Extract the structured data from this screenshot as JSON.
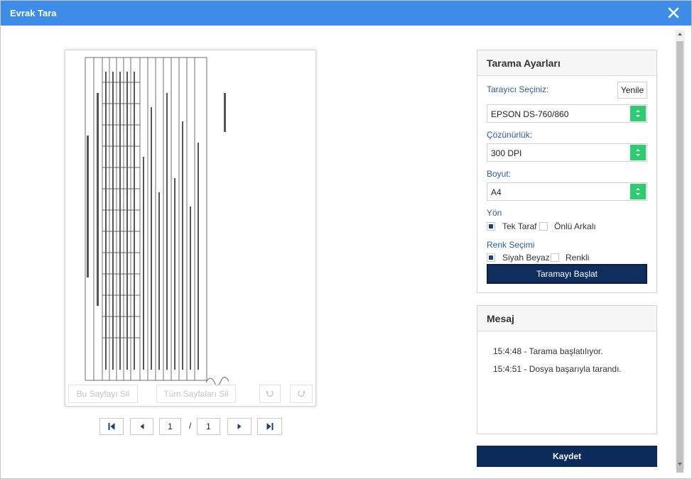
{
  "dialog": {
    "title": "Evrak Tara"
  },
  "preview": {
    "overlay": {
      "delete_label": "Bu Sayfayı Sil",
      "delete_all_label": "Tüm Sayfaları Sil"
    },
    "pager": {
      "current_page": "1",
      "separator": "/",
      "total_pages": "1"
    }
  },
  "settings": {
    "title": "Tarama Ayarları",
    "scanner_label": "Tarayıcı Seçiniz:",
    "refresh_label": "Yenile",
    "scanner_value": "EPSON DS-760/860",
    "resolution_label": "Çözünürlük:",
    "resolution_value": "300 DPI",
    "size_label": "Boyut:",
    "size_value": "A4",
    "orientation_label": "Yön",
    "orientation_options": [
      {
        "label": "Tek Taraf",
        "checked": true
      },
      {
        "label": "Önlü Arkalı",
        "checked": false
      }
    ],
    "color_label": "Renk Seçimi",
    "color_options": [
      {
        "label": "Siyah Beyaz",
        "checked": true
      },
      {
        "label": "Renkli",
        "checked": false
      }
    ],
    "start_label": "Taramayı Başlat"
  },
  "message": {
    "title": "Mesaj",
    "lines": [
      "15:4:48 - Tarama başlatılıyor.",
      "15:4:51 - Dosya başarıyla tarandı."
    ]
  },
  "save_label": "Kaydet",
  "colors": {
    "titlebar": "#3d8ce8",
    "primary_button": "#0c2a5a",
    "select_arrow": "#2ecc71",
    "label": "#2a5c9a"
  }
}
